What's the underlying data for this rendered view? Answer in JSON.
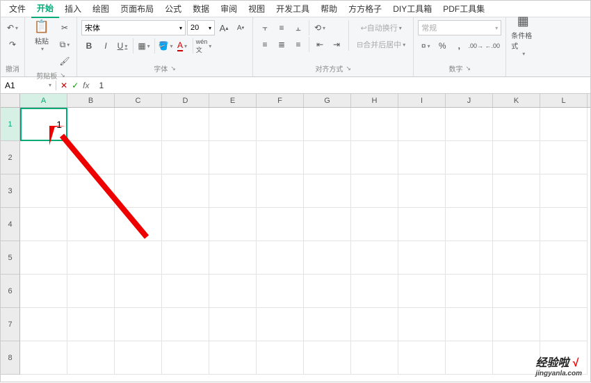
{
  "menu": {
    "tabs": [
      "文件",
      "开始",
      "插入",
      "绘图",
      "页面布局",
      "公式",
      "数据",
      "审阅",
      "视图",
      "开发工具",
      "帮助",
      "方方格子",
      "DIY工具箱",
      "PDF工具集"
    ],
    "active_index": 1
  },
  "ribbon": {
    "undo": {
      "label": "撤消"
    },
    "clipboard": {
      "paste": "粘贴",
      "label": "剪贴板"
    },
    "font": {
      "name": "宋体",
      "size": "20",
      "bold": "B",
      "italic": "I",
      "underline": "U",
      "increase": "A",
      "decrease": "A",
      "label": "字体"
    },
    "align": {
      "wrap": "自动换行",
      "merge": "合并后居中",
      "label": "对齐方式"
    },
    "number": {
      "format": "常规",
      "percent": "%",
      "comma": ",",
      "inc": "⁴⁰",
      "dec": "⁰⁰",
      "label": "数字"
    },
    "styles": {
      "cond": "条件格式",
      "label": ""
    }
  },
  "formula": {
    "namebox": "A1",
    "cancel": "✕",
    "ok": "✓",
    "fx": "fx",
    "value": "1"
  },
  "grid": {
    "cols": [
      "A",
      "B",
      "C",
      "D",
      "E",
      "F",
      "G",
      "H",
      "I",
      "J",
      "K",
      "L"
    ],
    "rows": [
      "1",
      "2",
      "3",
      "4",
      "5",
      "6",
      "7",
      "8"
    ],
    "active_cell": {
      "col": 0,
      "row": 0,
      "value": "1"
    }
  },
  "watermark": {
    "text": "经验啦",
    "check": "√",
    "sub": "jingyanla.com"
  }
}
